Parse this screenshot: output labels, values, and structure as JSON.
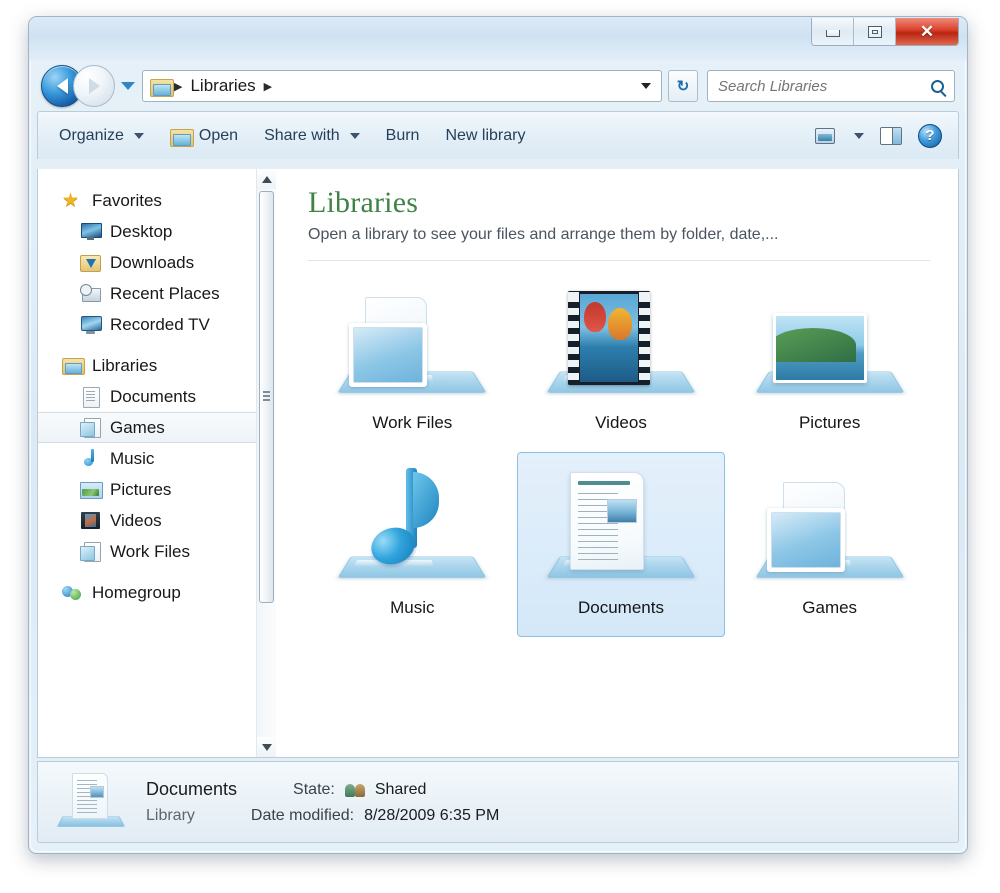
{
  "window": {
    "buttons": {
      "minimize": "minimize-button",
      "maximize": "restore-button",
      "close_glyph": "✕"
    }
  },
  "address": {
    "back_tip": "Back",
    "forward_tip": "Forward",
    "history_tip": "Recent pages",
    "root_icon": "libraries-folder-icon",
    "crumbs": [
      "Libraries"
    ],
    "separator": "▶",
    "refresh_glyph": "↻"
  },
  "search": {
    "placeholder": "Search Libraries",
    "value": ""
  },
  "toolbar": {
    "organize": "Organize",
    "open": "Open",
    "share_with": "Share with",
    "burn": "Burn",
    "new_library": "New library",
    "help_glyph": "?"
  },
  "sidebar": {
    "groups": [
      {
        "header": {
          "label": "Favorites",
          "icon": "star-icon"
        },
        "items": [
          {
            "label": "Desktop",
            "icon": "desktop-icon"
          },
          {
            "label": "Downloads",
            "icon": "downloads-icon"
          },
          {
            "label": "Recent Places",
            "icon": "recent-places-icon"
          },
          {
            "label": "Recorded TV",
            "icon": "recorded-tv-icon"
          }
        ]
      },
      {
        "header": {
          "label": "Libraries",
          "icon": "libraries-icon"
        },
        "items": [
          {
            "label": "Documents",
            "icon": "documents-icon",
            "state": "normal"
          },
          {
            "label": "Games",
            "icon": "generic-library-icon",
            "state": "hover"
          },
          {
            "label": "Music",
            "icon": "music-icon",
            "state": "normal"
          },
          {
            "label": "Pictures",
            "icon": "pictures-icon",
            "state": "normal"
          },
          {
            "label": "Videos",
            "icon": "videos-icon",
            "state": "normal"
          },
          {
            "label": "Work Files",
            "icon": "generic-library-icon",
            "state": "normal"
          }
        ]
      },
      {
        "header": {
          "label": "Homegroup",
          "icon": "homegroup-icon"
        },
        "items": []
      }
    ]
  },
  "content": {
    "title": "Libraries",
    "subtitle": "Open a library to see your files and arrange them by folder, date,...",
    "tiles": [
      {
        "label": "Work Files",
        "icon": "generic-library-icon",
        "selected": false
      },
      {
        "label": "Videos",
        "icon": "videos-library-icon",
        "selected": false
      },
      {
        "label": "Pictures",
        "icon": "pictures-library-icon",
        "selected": false
      },
      {
        "label": "Music",
        "icon": "music-library-icon",
        "selected": false
      },
      {
        "label": "Documents",
        "icon": "documents-library-icon",
        "selected": true
      },
      {
        "label": "Games",
        "icon": "generic-library-icon",
        "selected": false
      }
    ]
  },
  "status": {
    "name": "Documents",
    "type": "Library",
    "state_label": "State:",
    "state_value": "Shared",
    "date_label": "Date modified:",
    "date_value": "8/28/2009 6:35 PM"
  },
  "colors": {
    "title_green": "#3f8346",
    "selection_blue": "#8fbfe3",
    "close_red": "#b72510",
    "frame_blue": "#dbe9f4"
  }
}
